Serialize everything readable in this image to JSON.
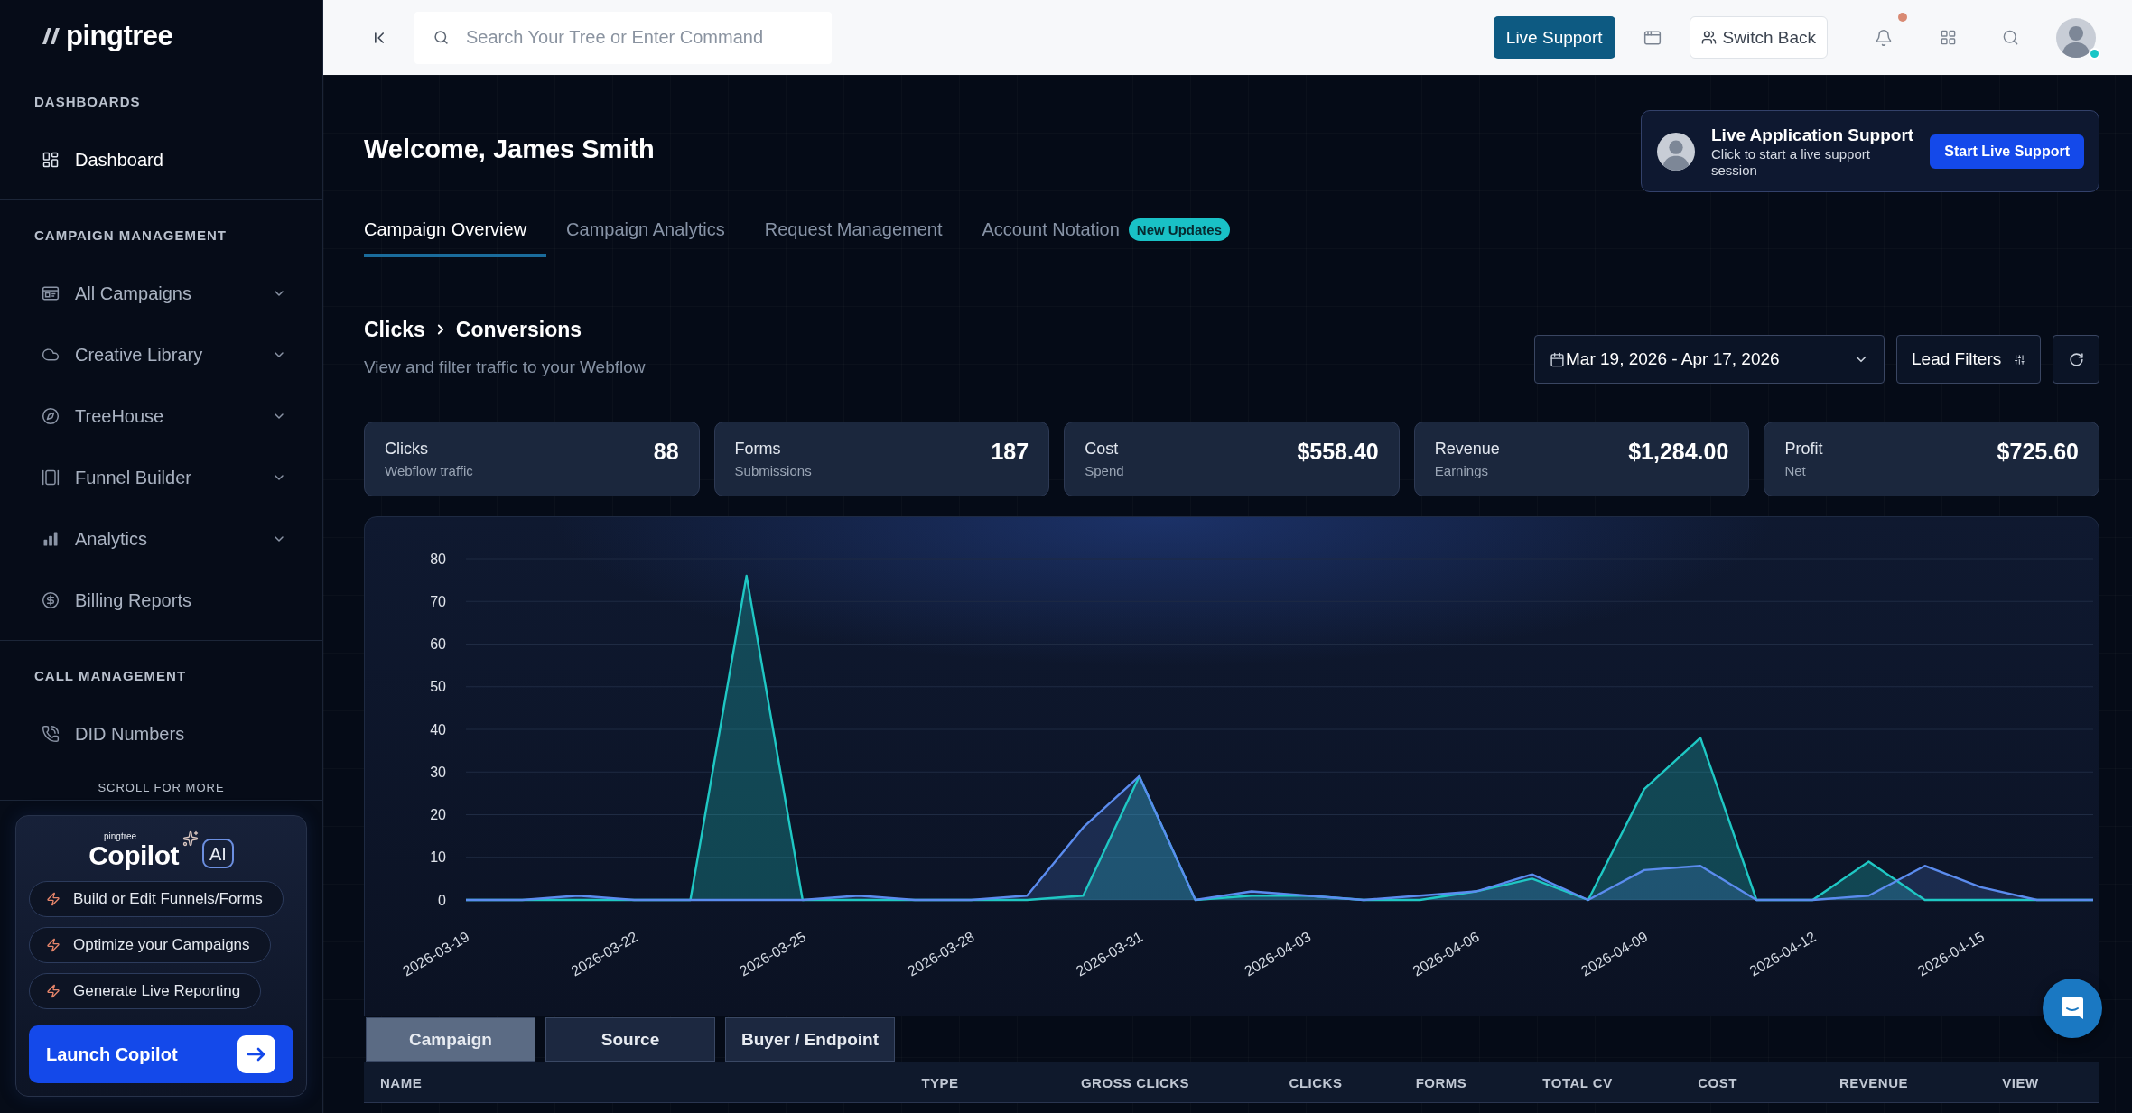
{
  "sidebar": {
    "logo": "pingtree",
    "sections": [
      {
        "heading": "DASHBOARDS",
        "items": [
          {
            "label": "Dashboard",
            "selected": true,
            "has_submenu": false
          }
        ]
      },
      {
        "heading": "CAMPAIGN MANAGEMENT",
        "items": [
          {
            "label": "All Campaigns",
            "selected": false,
            "has_submenu": true
          },
          {
            "label": "Creative Library",
            "selected": false,
            "has_submenu": true
          },
          {
            "label": "TreeHouse",
            "selected": false,
            "has_submenu": true
          },
          {
            "label": "Funnel Builder",
            "selected": false,
            "has_submenu": true
          },
          {
            "label": "Analytics",
            "selected": false,
            "has_submenu": true
          },
          {
            "label": "Billing Reports",
            "selected": false,
            "has_submenu": false
          }
        ]
      },
      {
        "heading": "CALL MANAGEMENT",
        "items": [
          {
            "label": "DID Numbers",
            "selected": false,
            "has_submenu": false
          }
        ]
      }
    ],
    "scroll_hint": "SCROLL FOR MORE",
    "copilot": {
      "brand": "pingtree",
      "title": "Copilot",
      "badge": "AI",
      "suggestions": [
        "Build or Edit Funnels/Forms",
        "Optimize your Campaigns",
        "Generate Live Reporting"
      ],
      "button": "Launch Copilot"
    }
  },
  "topbar": {
    "search": {
      "placeholder": "Search Your Tree or Enter Command"
    },
    "live_support_button": "Live Support",
    "switch_back_button": "Switch Back",
    "unread_notifications": true,
    "user_online": true
  },
  "header": {
    "greeting": "Welcome, James Smith",
    "support_card": {
      "title": "Live Application Support",
      "text": "Click to start a live support session",
      "button": "Start Live Support"
    }
  },
  "tabs": [
    {
      "label": "Campaign Overview",
      "selected": true
    },
    {
      "label": "Campaign Analytics",
      "selected": false
    },
    {
      "label": "Request Management",
      "selected": false
    },
    {
      "label": "Account Notation",
      "selected": false,
      "badge": "New Updates"
    }
  ],
  "section": {
    "breadcrumb": [
      "Clicks",
      "Conversions"
    ],
    "subtitle": "View and filter traffic to your Webflow",
    "date_range": "Mar 19, 2026 - Apr 17, 2026",
    "filter_button": "Lead Filters"
  },
  "stats": [
    {
      "label": "Clicks",
      "sublabel": "Webflow traffic",
      "value": "88"
    },
    {
      "label": "Forms",
      "sublabel": "Submissions",
      "value": "187"
    },
    {
      "label": "Cost",
      "sublabel": "Spend",
      "value": "$558.40"
    },
    {
      "label": "Revenue",
      "sublabel": "Earnings",
      "value": "$1,284.00"
    },
    {
      "label": "Profit",
      "sublabel": "Net",
      "value": "$725.60"
    }
  ],
  "chart": {
    "chart_data": {
      "type": "area",
      "categories": [
        "2026-03-19",
        null,
        null,
        "2026-03-22",
        null,
        null,
        "2026-03-25",
        null,
        null,
        "2026-03-28",
        null,
        null,
        "2026-03-31",
        null,
        null,
        "2026-04-03",
        null,
        null,
        "2026-04-06",
        null,
        null,
        "2026-04-09",
        null,
        null,
        "2026-04-12",
        null,
        null,
        "2026-04-15",
        null,
        null
      ],
      "series": [
        {
          "color": "#1fc8c4",
          "values": [
            0,
            0,
            0,
            0,
            0,
            76,
            0,
            0,
            0,
            0,
            0,
            1,
            29,
            0,
            1,
            1,
            0,
            0,
            2,
            5,
            0,
            26,
            38,
            0,
            0,
            9,
            0,
            0,
            0,
            0
          ]
        },
        {
          "color": "#5b8cef",
          "values": [
            0,
            0,
            1,
            0,
            0,
            0,
            0,
            1,
            0,
            0,
            1,
            17,
            29,
            0,
            2,
            1,
            0,
            1,
            2,
            6,
            0,
            7,
            8,
            0,
            0,
            1,
            8,
            3,
            0,
            0
          ]
        }
      ],
      "ylim": [
        0,
        80
      ],
      "yticks": [
        0,
        10,
        20,
        30,
        40,
        50,
        60,
        70,
        80
      ],
      "grid": true
    }
  },
  "table": {
    "tabs": [
      {
        "label": "Campaign",
        "selected": true
      },
      {
        "label": "Source",
        "selected": false
      },
      {
        "label": "Buyer / Endpoint",
        "selected": false
      }
    ],
    "columns": [
      "NAME",
      "TYPE",
      "GROSS CLICKS",
      "CLICKS",
      "FORMS",
      "TOTAL CV",
      "COST",
      "REVENUE",
      "VIEW"
    ]
  }
}
